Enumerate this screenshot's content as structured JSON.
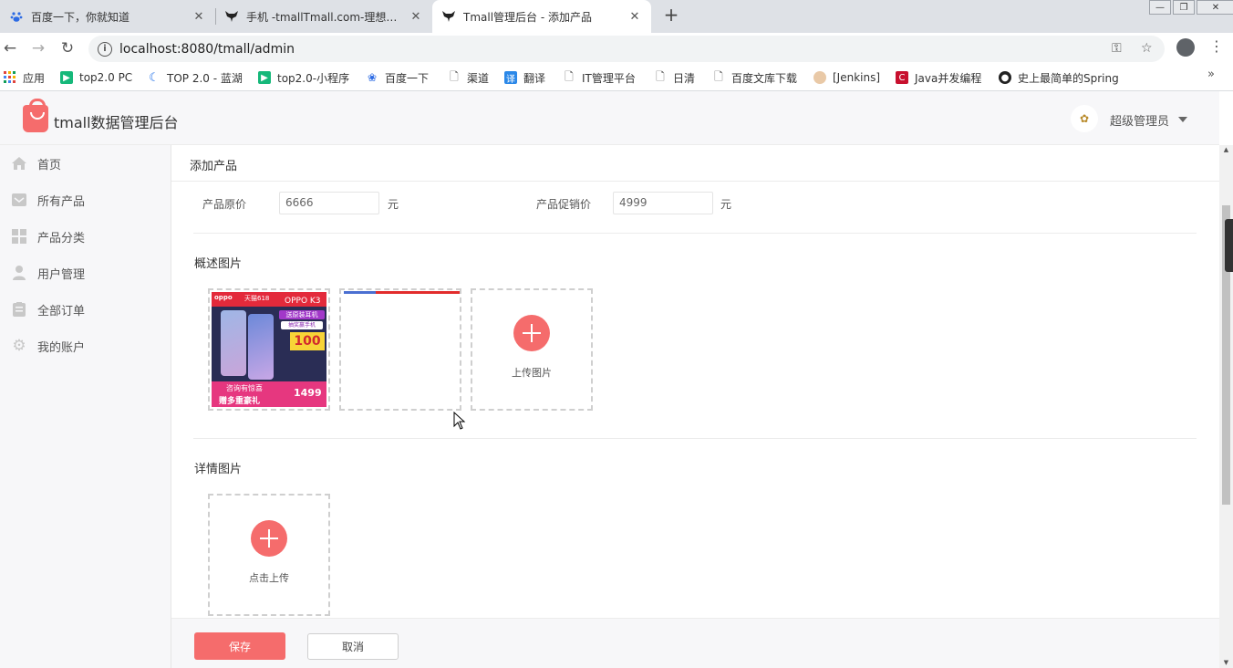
{
  "browser": {
    "tabs": [
      {
        "title": "百度一下，你就知道"
      },
      {
        "title": "手机 -tmallTmall.com-理想生活"
      },
      {
        "title": "Tmall管理后台 - 添加产品"
      }
    ],
    "url": "localhost:8080/tmall/admin",
    "bookmarks": [
      {
        "label": "应用"
      },
      {
        "label": "top2.0 PC"
      },
      {
        "label": "TOP 2.0 - 蓝湖"
      },
      {
        "label": "top2.0-小程序"
      },
      {
        "label": "百度一下"
      },
      {
        "label": "渠道"
      },
      {
        "label": "翻译"
      },
      {
        "label": "IT管理平台"
      },
      {
        "label": "日清"
      },
      {
        "label": "百度文库下载"
      },
      {
        "label": "[Jenkins]"
      },
      {
        "label": "Java并发编程"
      },
      {
        "label": "史上最简单的Spring"
      }
    ]
  },
  "header": {
    "app_title": "tmall数据管理后台",
    "user_name": "超级管理员"
  },
  "sidebar": {
    "items": [
      {
        "label": "首页",
        "icon": "home-icon"
      },
      {
        "label": "所有产品",
        "icon": "product-icon"
      },
      {
        "label": "产品分类",
        "icon": "category-icon"
      },
      {
        "label": "用户管理",
        "icon": "user-icon"
      },
      {
        "label": "全部订单",
        "icon": "order-icon"
      },
      {
        "label": "我的账户",
        "icon": "gear-icon"
      }
    ]
  },
  "main": {
    "title": "添加产品",
    "original_price": {
      "label": "产品原价",
      "value": "6666",
      "unit": "元"
    },
    "promo_price": {
      "label": "产品促销价",
      "value": "4999",
      "unit": "元"
    },
    "summary_images": {
      "label": "概述图片",
      "upload_text": "上传图片"
    },
    "detail_images": {
      "label": "详情图片",
      "upload_text": "点击上传"
    },
    "thumb": {
      "brand": "oppo",
      "tmall": "天猫618",
      "model": "OPPO K3",
      "tag1": "送原装耳机",
      "tag2": "抽奖赢手机",
      "big": "100",
      "line1": "咨询有惊喜",
      "line2": "赠多重豪礼",
      "price": "1499"
    }
  },
  "footer": {
    "save_label": "保存",
    "cancel_label": "取消"
  }
}
